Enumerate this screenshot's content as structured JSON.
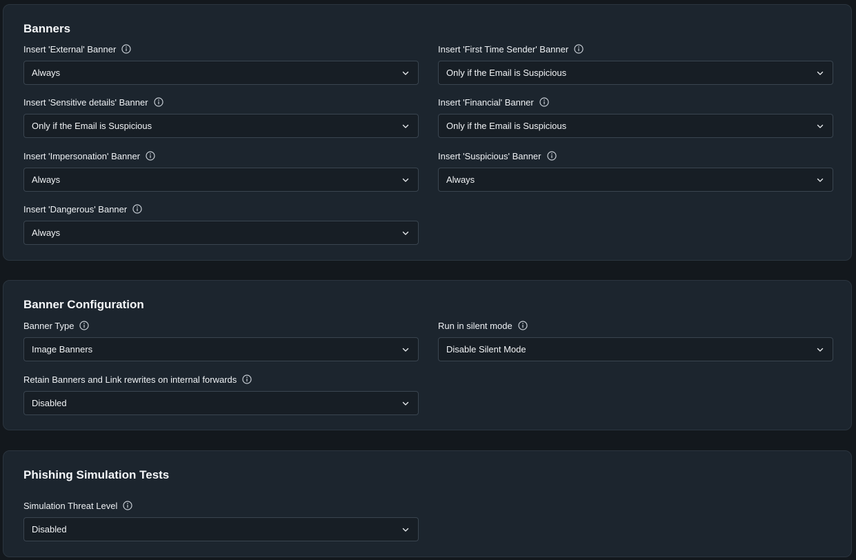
{
  "sections": {
    "banners": {
      "title": "Banners",
      "fields": {
        "external": {
          "label": "Insert 'External' Banner",
          "value": "Always"
        },
        "first_time_sender": {
          "label": "Insert 'First Time Sender' Banner",
          "value": "Only if the Email is Suspicious"
        },
        "sensitive_details": {
          "label": "Insert 'Sensitive details' Banner",
          "value": "Only if the Email is Suspicious"
        },
        "financial": {
          "label": "Insert 'Financial' Banner",
          "value": "Only if the Email is Suspicious"
        },
        "impersonation": {
          "label": "Insert 'Impersonation' Banner",
          "value": "Always"
        },
        "suspicious": {
          "label": "Insert 'Suspicious' Banner",
          "value": "Always"
        },
        "dangerous": {
          "label": "Insert 'Dangerous' Banner",
          "value": "Always"
        }
      }
    },
    "banner_configuration": {
      "title": "Banner Configuration",
      "fields": {
        "banner_type": {
          "label": "Banner Type",
          "value": "Image Banners"
        },
        "silent_mode": {
          "label": "Run in silent mode",
          "value": "Disable Silent Mode"
        },
        "retain_banners": {
          "label": "Retain Banners and Link rewrites on internal forwards",
          "value": "Disabled"
        }
      }
    },
    "phishing_simulation": {
      "title": "Phishing Simulation Tests",
      "fields": {
        "threat_level": {
          "label": "Simulation Threat Level",
          "value": "Disabled"
        }
      }
    }
  },
  "icons": {
    "info": "info-icon",
    "dropdown": "chevron-down-icon"
  },
  "colors": {
    "page_background": "#13181d",
    "card_background": "#1c252e",
    "card_border": "#2b353f",
    "select_background": "#171e25",
    "select_border": "#3a4550",
    "text": "#eef1f4"
  }
}
